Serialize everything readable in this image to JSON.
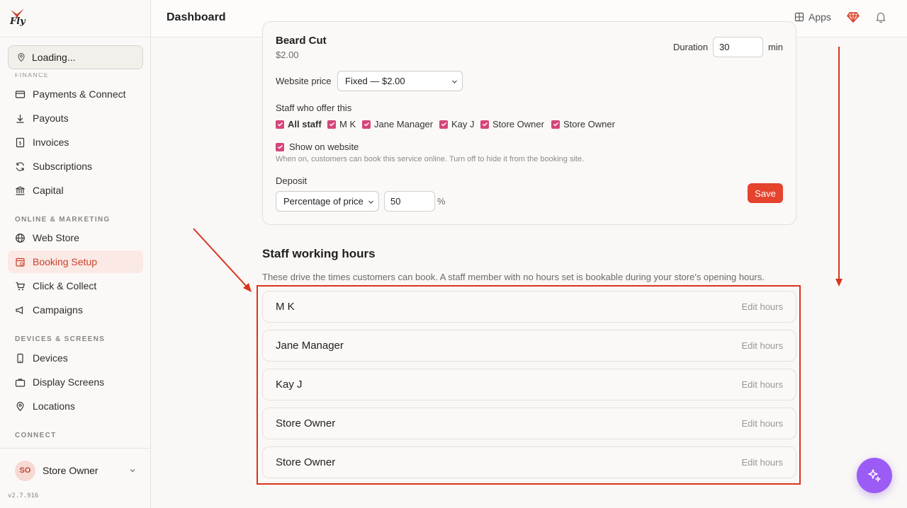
{
  "app": {
    "logo_text": "Fly",
    "version": "v2.7.916"
  },
  "header": {
    "title": "Dashboard",
    "apps_label": "Apps"
  },
  "sidebar": {
    "location_select": "Loading...",
    "clipped_section": "FINANCE",
    "items_finance": [
      {
        "label": "Payments & Connect",
        "icon": "credit-card-icon"
      },
      {
        "label": "Payouts",
        "icon": "download-icon"
      },
      {
        "label": "Invoices",
        "icon": "invoice-icon"
      },
      {
        "label": "Subscriptions",
        "icon": "refresh-icon"
      },
      {
        "label": "Capital",
        "icon": "bank-icon"
      }
    ],
    "section_online": "ONLINE & MARKETING",
    "items_online": [
      {
        "label": "Web Store",
        "icon": "globe-icon"
      },
      {
        "label": "Booking Setup",
        "icon": "calendar-icon",
        "active": true
      },
      {
        "label": "Click & Collect",
        "icon": "cart-icon"
      },
      {
        "label": "Campaigns",
        "icon": "megaphone-icon"
      }
    ],
    "section_devices": "DEVICES & SCREENS",
    "items_devices": [
      {
        "label": "Devices",
        "icon": "phone-icon"
      },
      {
        "label": "Display Screens",
        "icon": "briefcase-icon"
      },
      {
        "label": "Locations",
        "icon": "pin-icon"
      }
    ],
    "section_connect": "CONNECT",
    "user": {
      "initials": "SO",
      "name": "Store Owner"
    }
  },
  "service": {
    "name": "Beard Cut",
    "price": "$2.00",
    "duration_label": "Duration",
    "duration_value": "30",
    "duration_unit": "min",
    "website_price_label": "Website price",
    "website_price_value": "Fixed — $2.00",
    "staff_label": "Staff who offer this",
    "staff_checkboxes": [
      "All staff",
      "M K",
      "Jane Manager",
      "Kay J",
      "Store Owner",
      "Store Owner"
    ],
    "show_on_website_label": "Show on website",
    "show_on_website_help": "When on, customers can book this service online. Turn off to hide it from the booking site.",
    "deposit_label": "Deposit",
    "deposit_type": "Percentage of price",
    "deposit_value": "50",
    "deposit_unit": "%",
    "save_label": "Save"
  },
  "staff_hours": {
    "title": "Staff working hours",
    "description": "These drive the times customers can book. A staff member with no hours set is bookable during your store's opening hours.",
    "edit_label": "Edit hours",
    "rows": [
      "M K",
      "Jane Manager",
      "Kay J",
      "Store Owner",
      "Store Owner"
    ]
  },
  "colors": {
    "accent": "#e5432e",
    "checkbox": "#d6457a",
    "annotation": "#d9341f",
    "fab": "#9b5cf6"
  }
}
